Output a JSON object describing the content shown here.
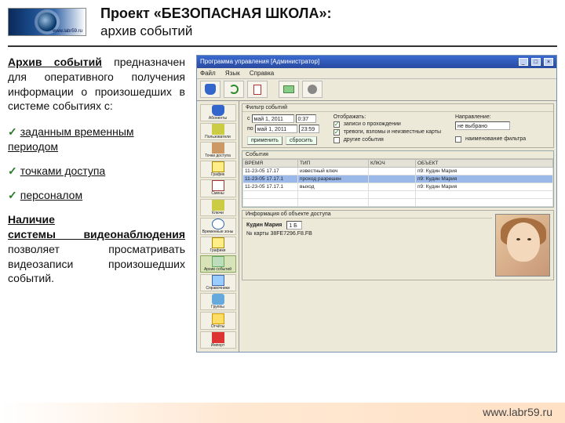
{
  "header": {
    "logo_text": "www.labr59.ru",
    "title_line1": "Проект «БЕЗОПАСНАЯ ШКОЛА»:",
    "title_line2": "архив событий"
  },
  "left_text": {
    "intro_b": "Архив событий",
    "intro_rest": " предназначен для оперативного получения информации о произошедших в системе событиях с:",
    "b1": "заданным временным периодом",
    "b2": "точками доступа",
    "b3": "персоналом",
    "note_b1": "Наличие",
    "note_b2": "системы видеонаблюдения",
    "note_rest": " позволяет просматривать видеозаписи произошедших событий."
  },
  "app": {
    "title": "Программа управления [Администратор]",
    "menu": {
      "file": "Файл",
      "lang": "Язык",
      "help": "Справка"
    },
    "win_btn_min": "_",
    "win_btn_max": "□",
    "win_btn_close": "×",
    "sidebar": [
      "Абоненты",
      "Пользователи",
      "Точки доступа",
      "График",
      "Смены",
      "Ключи",
      "Временные зоны",
      "Графики",
      "Архив событий",
      "Справочники",
      "Группы",
      "Отчёты",
      "Импорт"
    ],
    "filter": {
      "title": "Фильтр событий",
      "from_label": "с",
      "from_date": "май 1, 2011",
      "from_time": "0:37",
      "to_label": "по",
      "to_date": "май 1, 2011",
      "to_time": "23:59",
      "btn_apply": "применить",
      "btn_reset": "сбросить",
      "col2_h": "Отображать:",
      "c1": "записи о прохождении",
      "c2": "тревоги, взломы и неизвестные карты",
      "c3": "другие события",
      "col3_h": "Направление:",
      "c4": "не выбрано",
      "c5": "наименование фильтра"
    },
    "grid": {
      "title": "События",
      "col1": "ВРЕМЯ",
      "col2": "ТИП",
      "col3": "КЛЮЧ",
      "col4": "ОБЪЕКТ",
      "rows": [
        {
          "t": "11-23-05 17.17",
          "tp": "известный ключ",
          "k": "",
          "o": "п9: Кудин Мария"
        },
        {
          "t": "11-23-05 17.17.1",
          "tp": "проход разрешен",
          "k": "",
          "o": "п9: Кудин Мария"
        },
        {
          "t": "11-23-05 17.17.1",
          "tp": "выход",
          "k": "",
          "o": "п9: Кудин Мария"
        }
      ]
    },
    "info": {
      "title": "Информация об объекте доступа",
      "name_l": "Кудин Мария",
      "class_l": "1 Б",
      "card_l": "№ карты 38FE7296.F8.FB",
      "photo_alt": "фото ученика"
    }
  },
  "footer": "www.labr59.ru"
}
